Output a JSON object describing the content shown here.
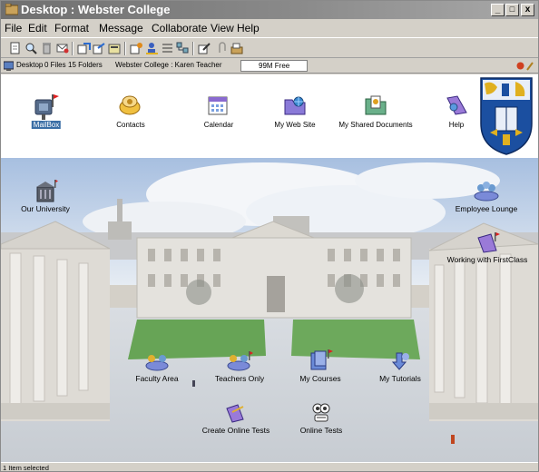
{
  "window": {
    "title": "Desktop : Webster College",
    "min": "_",
    "max": "□",
    "close": "x"
  },
  "menu": [
    "File",
    "Edit",
    "Format",
    "Message",
    "Collaborate",
    "View",
    "Help"
  ],
  "toolbar_icons": [
    "new-document-icon",
    "find-icon",
    "delete-icon",
    "reply-icon",
    "send-icon",
    "forward-icon",
    "history-icon",
    "properties-icon",
    "user-icon",
    "list-view-icon",
    "outline-icon",
    "compose-icon",
    "attach-icon",
    "open-icon"
  ],
  "pathbar": {
    "desktop": "Desktop",
    "files": "0 Files",
    "folders": "15 Folders",
    "user": "Webster College : Karen Teacher",
    "free": "99M Free"
  },
  "top_icons": [
    {
      "name": "mailbox",
      "label": "MailBox",
      "selected": true
    },
    {
      "name": "contacts",
      "label": "Contacts"
    },
    {
      "name": "calendar",
      "label": "Calendar"
    },
    {
      "name": "my-web-site",
      "label": "My Web Site"
    },
    {
      "name": "my-shared-documents",
      "label": "My Shared Documents"
    },
    {
      "name": "help",
      "label": "Help"
    }
  ],
  "scene_icons": [
    {
      "name": "our-university",
      "label": "Our University"
    },
    {
      "name": "employee-lounge",
      "label": "Employee Lounge"
    },
    {
      "name": "working-with-firstclass",
      "label": "Working with FirstClass"
    },
    {
      "name": "faculty-area",
      "label": "Faculty Area"
    },
    {
      "name": "teachers-only",
      "label": "Teachers Only"
    },
    {
      "name": "my-courses",
      "label": "My Courses"
    },
    {
      "name": "my-tutorials",
      "label": "My Tutorials"
    },
    {
      "name": "create-online-tests",
      "label": "Create Online Tests"
    },
    {
      "name": "online-tests",
      "label": "Online Tests"
    }
  ],
  "status": "1 Item selected",
  "colors": {
    "titlebar": "#7a7a7a",
    "chrome": "#d4d0c8",
    "selection": "#3a6ea5",
    "flag": "#e02020",
    "crest_blue": "#1b4fa0",
    "crest_gold": "#e0b020"
  }
}
